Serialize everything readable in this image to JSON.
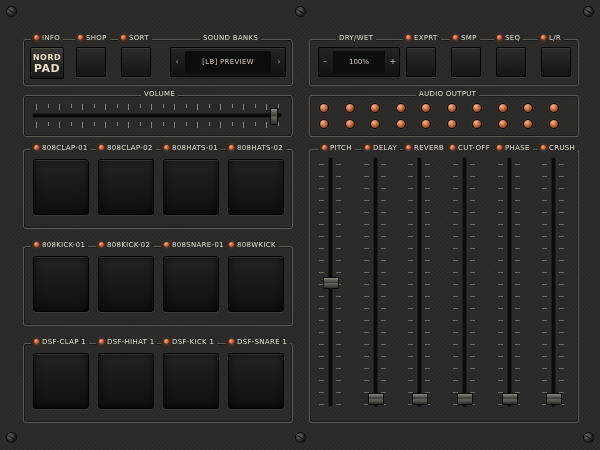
{
  "logo": {
    "line1": "NORD",
    "line2": "PAD"
  },
  "top_left": {
    "info_label": "INFO",
    "shop_label": "SHOP",
    "sort_label": "SORT",
    "banks_label": "SOUND BANKS",
    "bank_prev": "‹",
    "bank_next": "›",
    "bank_value": "[LB] PREVIEW"
  },
  "top_right": {
    "drywet_label": "DRY/WET",
    "drywet_minus": "–",
    "drywet_plus": "+",
    "drywet_value": "100%",
    "exprt_label": "EXPRT",
    "smp_label": "SMP",
    "seq_label": "SEQ",
    "lr_label": "L/R"
  },
  "volume": {
    "label": "VOLUME",
    "level": 0.97
  },
  "audio_output": {
    "label": "AUDIO OUTPUT",
    "rows": 2,
    "cols": 10
  },
  "pad_groups": [
    {
      "labels": [
        "808CLAP-01",
        "808CLAP-02",
        "808HATS-01",
        "808HATS-02"
      ]
    },
    {
      "labels": [
        "808KICK-01",
        "808KICK-02",
        "808SNARE-01",
        "808WKICK"
      ]
    },
    {
      "labels": [
        "DSF-CLAP 1",
        "DSF-HIHAT 1",
        "DSF-KICK 1",
        "DSF-SNARE 1"
      ]
    }
  ],
  "effects": {
    "labels": [
      "PITCH",
      "DELAY",
      "REVERB",
      "CUT-OFF",
      "PHASE",
      "CRUSH"
    ],
    "levels": [
      0.5,
      0.0,
      0.0,
      0.0,
      0.0,
      0.0
    ]
  },
  "colors": {
    "led": "#d9652f",
    "background": "#2b2a26"
  }
}
